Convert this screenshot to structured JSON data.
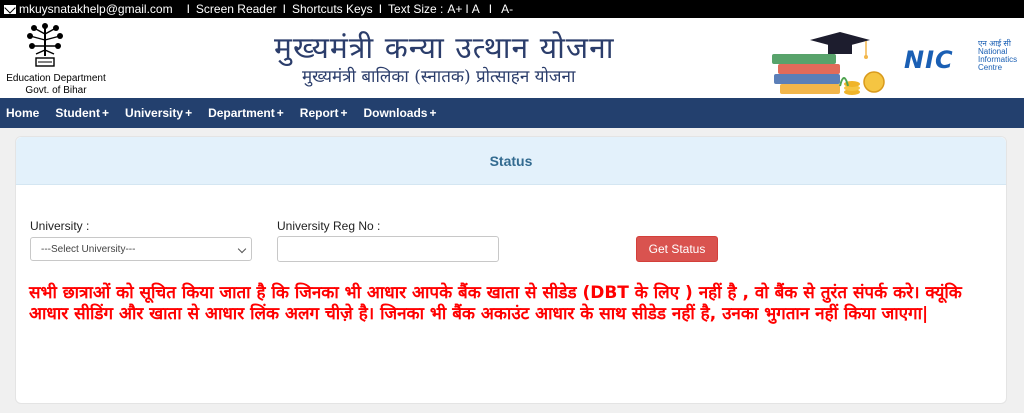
{
  "topbar": {
    "email": "mkuysnatakhelp@gmail.com",
    "links": [
      "Screen Reader",
      "Shortcuts Keys"
    ],
    "text_size_label": "Text Size :",
    "text_size_options": [
      "A+",
      "A",
      "A-"
    ],
    "separator": "I"
  },
  "header": {
    "dept_line1": "Education Department",
    "dept_line2": "Govt. of Bihar",
    "title": "मुख्यमंत्री कन्या उत्थान योजना",
    "subtitle": "मुख्यमंत्री बालिका (स्नातक) प्रोत्साहन योजना",
    "nic_hindi": "एन आई सी",
    "nic_short": "NIC",
    "nic_line1": "National",
    "nic_line2": "Informatics",
    "nic_line3": "Centre"
  },
  "nav": {
    "items": [
      {
        "label": "Home",
        "plus": ""
      },
      {
        "label": "Student",
        "plus": "+"
      },
      {
        "label": "University",
        "plus": "+"
      },
      {
        "label": "Department",
        "plus": "+"
      },
      {
        "label": "Report",
        "plus": "+"
      },
      {
        "label": "Downloads",
        "plus": "+"
      }
    ]
  },
  "status": {
    "title": "Status",
    "university_label": "University :",
    "university_selected": "---Select University---",
    "reg_label": "University Reg No :",
    "reg_value": "",
    "button": "Get Status",
    "notice": "सभी छात्राओं को सूचित किया जाता है कि जिनका भी आधार आपके बैंक खाता से सीडेड (DBT के लिए ) नहीं है , वो बैंक से तुरंत संपर्क करे। क्यूंकि आधार सीडिंग और खाता से आधार लिंक अलग चीज़े है। जिनका भी बैंक अकाउंट आधार के साथ सीडेड नहीं है, उनका भुगतान नहीं किया जाएगा|"
  },
  "colors": {
    "nav_bg": "#23406e",
    "panel_head_bg": "#e3f1fb",
    "title_color": "#2b3d6b",
    "button_bg": "#d9534f",
    "notice_color": "#ff0000"
  }
}
